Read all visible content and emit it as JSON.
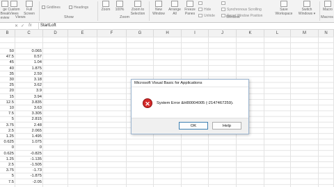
{
  "ribbon": {
    "views": {
      "page_break": "ge Break",
      "page_break2": "eview",
      "custom_views": "Custom",
      "custom_views2": "Views",
      "full_screen": "Full",
      "full_screen2": "Screen",
      "group": "Views"
    },
    "show": {
      "gridlines": "Gridlines",
      "headings": "Headings",
      "group": "Show"
    },
    "zoom": {
      "zoom": "Zoom",
      "hundred": "100%",
      "to_selection": "Zoom to",
      "to_selection2": "Selection",
      "group": "Zoom"
    },
    "window": {
      "new_window": "New",
      "new_window2": "Window",
      "arrange_all": "Arrange",
      "arrange_all2": "All",
      "freeze": "Freeze",
      "freeze2": "Panes",
      "hide": "Hide",
      "unhide": "Unhide",
      "sync": "Synchronous Scrolling",
      "reset": "Reset Window Position",
      "group": "Window"
    },
    "save_ws": "Save",
    "save_ws2": "Workspace",
    "switch": "Switch",
    "switch2": "Windows",
    "macros": "Macro",
    "macros_group": "Macros"
  },
  "formula_bar": {
    "value": "StartLoft"
  },
  "columns": [
    "B",
    "C",
    "D",
    "E",
    "F",
    "G",
    "H",
    "I",
    "J",
    "K",
    "L",
    "M",
    "N"
  ],
  "col_b": [
    "50",
    "47.5",
    "45",
    "40",
    "35",
    "30",
    "25",
    "20",
    "15",
    "12.5",
    "10",
    "7.5",
    "5",
    "3.75",
    "2.5",
    "1.25",
    "0.625",
    "0",
    "0.625",
    "1.25",
    "2.5",
    "3.75",
    "5",
    "7.5"
  ],
  "col_c": [
    "0.065",
    "0.57",
    "1.04",
    "1.875",
    "2.59",
    "3.18",
    "3.62",
    "3.9",
    "3.94",
    "3.835",
    "3.63",
    "3.305",
    "2.815",
    "2.48",
    "2.065",
    "1.495",
    "1.075",
    "0",
    "-0.825",
    "-1.135",
    "-1.505",
    "-1.73",
    "-1.875",
    "-2.05"
  ],
  "dialog": {
    "title": "Microsoft Visual Basic for Applications",
    "message": "System Error &H80004005 (-2147467259).",
    "ok": "OK",
    "help": "Help"
  }
}
